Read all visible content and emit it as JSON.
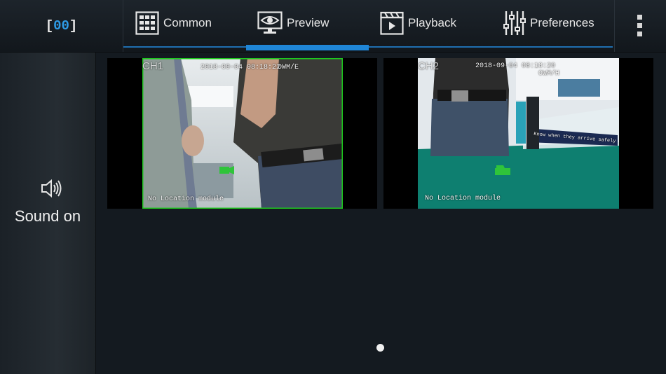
{
  "channel_indicator": {
    "open": "[",
    "number": "00",
    "close": "]"
  },
  "tabs": [
    {
      "label": "Common",
      "icon": "grid-icon"
    },
    {
      "label": "Preview",
      "icon": "monitor-eye-icon",
      "active": true
    },
    {
      "label": "Playback",
      "icon": "clapperboard-icon"
    },
    {
      "label": "Preferences",
      "icon": "sliders-icon"
    }
  ],
  "sidebar": {
    "sound_label": "Sound on",
    "icon": "speaker-icon"
  },
  "cameras": [
    {
      "channel": "CH1",
      "timestamp": "2018-09-04 08:18:22",
      "mode": "OWM/E",
      "footer": "No Location module",
      "selected": true
    },
    {
      "channel": "CH2",
      "timestamp": "2018-09-04 08:18:20",
      "mode": "OWM/H",
      "footer": "No Location module",
      "selected": false,
      "sign_text": "Know when they arrive safely"
    }
  ],
  "pagination": {
    "pages": 1,
    "current": 1
  },
  "colors": {
    "accent": "#1f86d6",
    "selection": "#1ec81e",
    "background": "#141a20",
    "record_icon": "#2fc43a"
  }
}
